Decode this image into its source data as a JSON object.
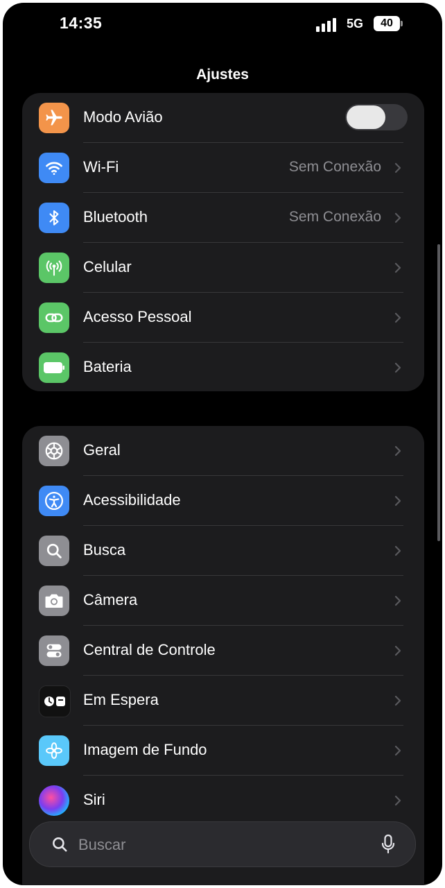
{
  "status_bar": {
    "time": "14:35",
    "network": "5G",
    "battery": "40"
  },
  "header": {
    "title": "Ajustes"
  },
  "group1": [
    {
      "label": "Modo Avião",
      "icon": "airplane-icon",
      "icon_bg": "#f3944a",
      "toggle": false
    },
    {
      "label": "Wi-Fi",
      "icon": "wifi-icon",
      "icon_bg": "#3f8af5",
      "value": "Sem Conexão"
    },
    {
      "label": "Bluetooth",
      "icon": "bluetooth-icon",
      "icon_bg": "#3f8af5",
      "value": "Sem Conexão"
    },
    {
      "label": "Celular",
      "icon": "cellular-icon",
      "icon_bg": "#5bc667"
    },
    {
      "label": "Acesso Pessoal",
      "icon": "personal-hotspot-icon",
      "icon_bg": "#5bc667"
    },
    {
      "label": "Bateria",
      "icon": "battery-icon",
      "icon_bg": "#5bc667"
    }
  ],
  "group2": [
    {
      "label": "Geral",
      "icon": "gear-icon",
      "icon_bg": "#8e8e93"
    },
    {
      "label": "Acessibilidade",
      "icon": "accessibility-icon",
      "icon_bg": "#3f8af5"
    },
    {
      "label": "Busca",
      "icon": "search-icon",
      "icon_bg": "#8e8e93"
    },
    {
      "label": "Câmera",
      "icon": "camera-icon",
      "icon_bg": "#8e8e93"
    },
    {
      "label": "Central de Controle",
      "icon": "control-center-icon",
      "icon_bg": "#8e8e93"
    },
    {
      "label": "Em Espera",
      "icon": "standby-icon",
      "icon_bg": "#111111"
    },
    {
      "label": "Imagem de Fundo",
      "icon": "wallpaper-icon",
      "icon_bg": "#5ac8fa"
    },
    {
      "label": "Siri",
      "icon": "siri-icon",
      "icon_bg": "#2a2a40"
    }
  ],
  "search": {
    "placeholder": "Buscar"
  }
}
